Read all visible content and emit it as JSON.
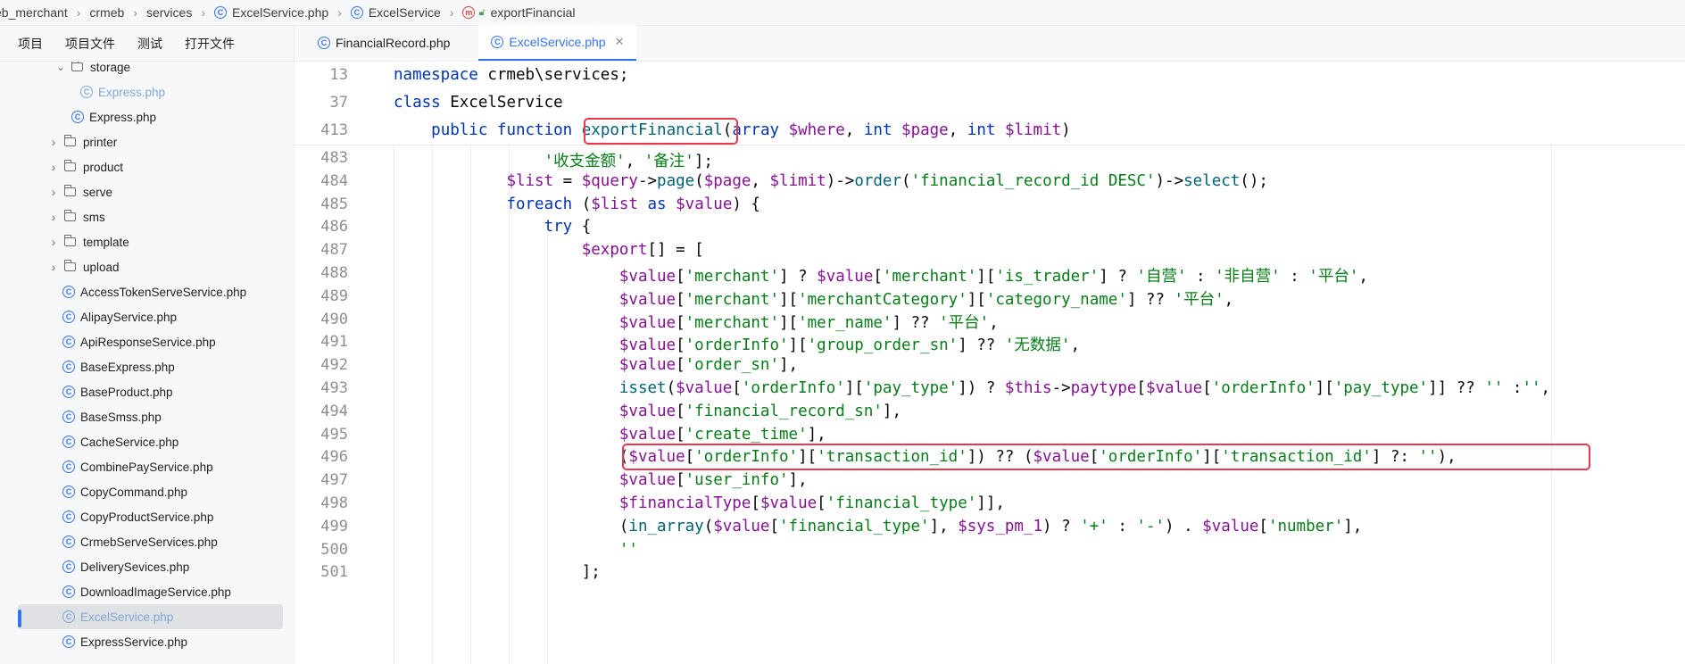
{
  "breadcrumb": [
    "eb_merchant",
    "crmeb",
    "services",
    "ExcelService.php",
    "ExcelService",
    "exportFinancial"
  ],
  "sidebar": {
    "tabs": [
      "项目",
      "项目文件",
      "测试",
      "打开文件"
    ],
    "tree": [
      {
        "label": "storage",
        "type": "folder",
        "expanded": true,
        "indent": 1
      },
      {
        "label": "Express.php",
        "type": "file",
        "indent": 3,
        "muted": true
      },
      {
        "label": "Express.php",
        "type": "file",
        "indent": 2
      },
      {
        "label": "printer",
        "type": "folder",
        "indent": 1
      },
      {
        "label": "product",
        "type": "folder",
        "indent": 1
      },
      {
        "label": "serve",
        "type": "folder",
        "indent": 1
      },
      {
        "label": "sms",
        "type": "folder",
        "indent": 1
      },
      {
        "label": "template",
        "type": "folder",
        "indent": 1
      },
      {
        "label": "upload",
        "type": "folder",
        "indent": 1
      },
      {
        "label": "AccessTokenServeService.php",
        "type": "file",
        "indent": 1
      },
      {
        "label": "AlipayService.php",
        "type": "file",
        "indent": 1
      },
      {
        "label": "ApiResponseService.php",
        "type": "file",
        "indent": 1
      },
      {
        "label": "BaseExpress.php",
        "type": "file",
        "indent": 1
      },
      {
        "label": "BaseProduct.php",
        "type": "file",
        "indent": 1
      },
      {
        "label": "BaseSmss.php",
        "type": "file",
        "indent": 1
      },
      {
        "label": "CacheService.php",
        "type": "file",
        "indent": 1
      },
      {
        "label": "CombinePayService.php",
        "type": "file",
        "indent": 1
      },
      {
        "label": "CopyCommand.php",
        "type": "file",
        "indent": 1
      },
      {
        "label": "CopyProductService.php",
        "type": "file",
        "indent": 1
      },
      {
        "label": "CrmebServeServices.php",
        "type": "file",
        "indent": 1
      },
      {
        "label": "DeliverySevices.php",
        "type": "file",
        "indent": 1
      },
      {
        "label": "DownloadImageService.php",
        "type": "file",
        "indent": 1
      },
      {
        "label": "ExcelService.php",
        "type": "file",
        "indent": 1,
        "selected": true,
        "muted": true
      },
      {
        "label": "ExpressService.php",
        "type": "file",
        "indent": 1
      }
    ]
  },
  "editor": {
    "tabs": [
      {
        "label": "FinancialRecord.php",
        "active": false
      },
      {
        "label": "ExcelService.php",
        "active": true
      }
    ],
    "sticky_lines": [
      {
        "num": "13",
        "text": "namespace crmeb\\services;"
      },
      {
        "num": "37",
        "text": "class ExcelService"
      },
      {
        "num": "413",
        "text": "    public function exportFinancial(array $where, int $page, int $limit)"
      }
    ],
    "lines": [
      {
        "num": "483",
        "text": "                '收支金额', '备注'];"
      },
      {
        "num": "484",
        "text": "            $list = $query->page($page, $limit)->order('financial_record_id DESC')->select();"
      },
      {
        "num": "485",
        "text": "            foreach ($list as $value) {"
      },
      {
        "num": "486",
        "text": "                try {"
      },
      {
        "num": "487",
        "text": "                    $export[] = ["
      },
      {
        "num": "488",
        "text": "                        $value['merchant'] ? $value['merchant']['is_trader'] ? '自营' : '非自营' : '平台',"
      },
      {
        "num": "489",
        "text": "                        $value['merchant']['merchantCategory']['category_name'] ?? '平台',"
      },
      {
        "num": "490",
        "text": "                        $value['merchant']['mer_name'] ?? '平台',"
      },
      {
        "num": "491",
        "text": "                        $value['orderInfo']['group_order_sn'] ?? '无数据',"
      },
      {
        "num": "492",
        "text": "                        $value['order_sn'],"
      },
      {
        "num": "493",
        "text": "                        isset($value['orderInfo']['pay_type']) ? $this->paytype[$value['orderInfo']['pay_type']] ?? '' :'',"
      },
      {
        "num": "494",
        "text": "                        $value['financial_record_sn'],"
      },
      {
        "num": "495",
        "text": "                        $value['create_time'],"
      },
      {
        "num": "496",
        "text": "                        ($value['orderInfo']['transaction_id']) ?? ($value['orderInfo']['transaction_id'] ?: ''),"
      },
      {
        "num": "497",
        "text": "                        $value['user_info'],"
      },
      {
        "num": "498",
        "text": "                        $financialType[$value['financial_type']],"
      },
      {
        "num": "499",
        "text": "                        (in_array($value['financial_type'], $sys_pm_1) ? '+' : '-') . $value['number'],"
      },
      {
        "num": "500",
        "text": "                        ''"
      },
      {
        "num": "501",
        "text": "                    ];"
      }
    ]
  }
}
